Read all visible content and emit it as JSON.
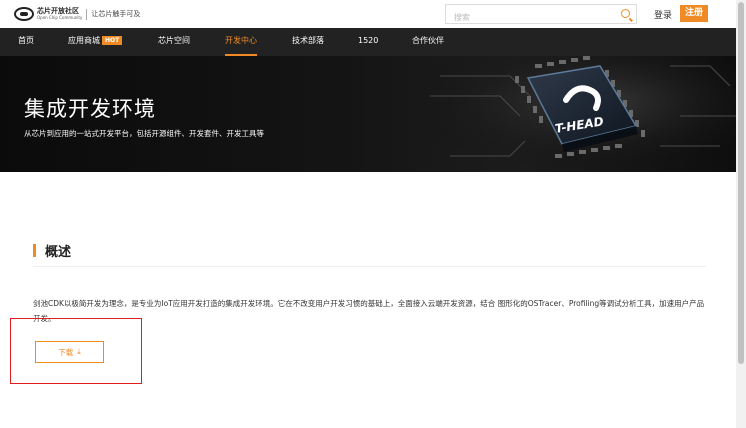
{
  "header": {
    "logo_name": "芯片开放社区",
    "logo_sub": "Open Chip Community",
    "slogan": "让芯片触手可及",
    "search_placeholder": "搜索",
    "login_label": "登录",
    "register_label": "注册"
  },
  "nav": {
    "items": [
      {
        "label": "首页"
      },
      {
        "label": "应用商城",
        "badge": "HOT"
      },
      {
        "label": "芯片空间"
      },
      {
        "label": "开发中心"
      },
      {
        "label": "技术部落"
      },
      {
        "label": "1520"
      },
      {
        "label": "合作伙伴"
      }
    ],
    "active_index": 3
  },
  "hero": {
    "title": "集成开发环境",
    "subtitle": "从芯片到应用的一站式开发平台，包括开源组件、开发套件、开发工具等",
    "chip_label": "T-HEAD"
  },
  "overview": {
    "title": "概述",
    "description": "剑池CDK以极简开发为理念，是专业为IoT应用开发打造的集成开发环境。它在不改变用户开发习惯的基础上，全面接入云端开发资源，结合 图形化的OSTracer、Profiling等调试分析工具，加速用户产品开发。",
    "download_label": "下载",
    "download_icon": "download-icon"
  },
  "colors": {
    "accent": "#f08a24",
    "nav_bg": "#222222",
    "highlight": "#e01d1d"
  }
}
